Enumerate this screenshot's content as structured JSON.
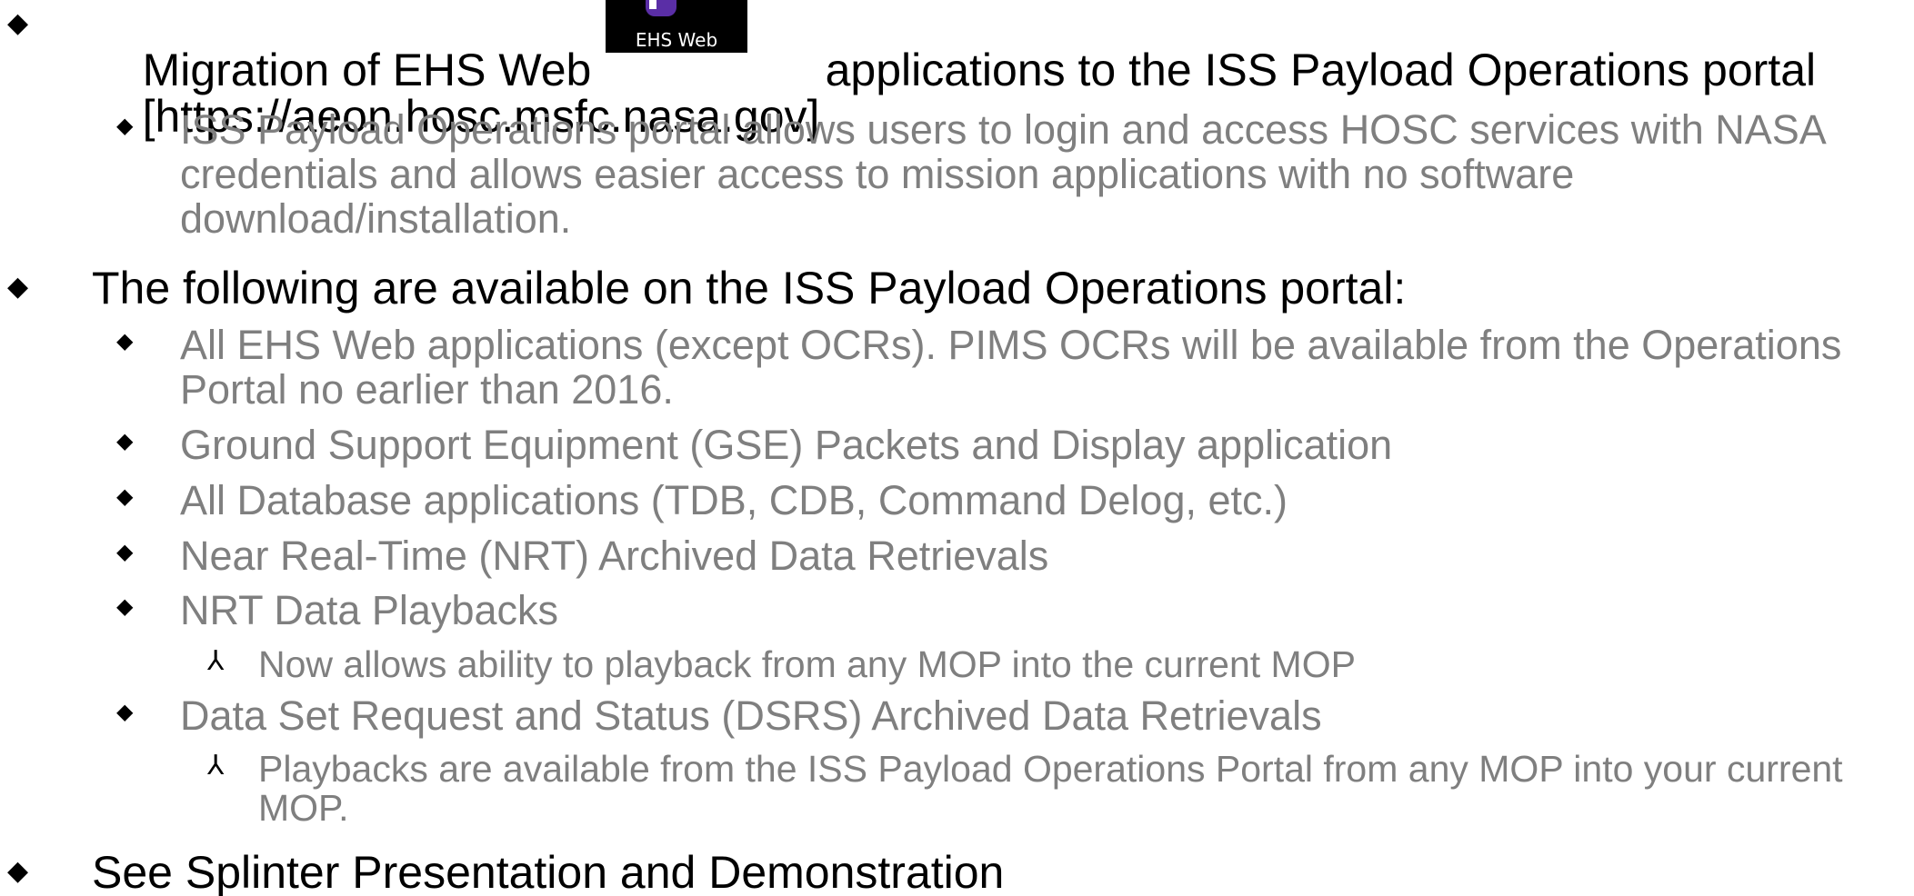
{
  "bullets": {
    "level1": "◆",
    "level2": "◆",
    "level3": "⅄"
  },
  "item1": {
    "text_before_icon": "Migration of EHS Web",
    "text_after_icon": "applications to the ISS Payload Operations portal",
    "text_line2": "[https://aeon.hosc.msfc.nasa.gov]",
    "icon_label": "EHS Web",
    "sub1": "ISS Payload Operations portal allows users to login and access HOSC services with NASA credentials and allows easier access to mission applications with no software download/installation."
  },
  "item2": {
    "text": "The following are available on the ISS Payload Operations portal:",
    "subs": [
      "All EHS Web applications (except OCRs). PIMS OCRs will be available from the Operations Portal no earlier than 2016.",
      "Ground Support Equipment (GSE) Packets and Display application",
      "All Database applications (TDB, CDB, Command Delog, etc.)",
      "Near Real-Time (NRT) Archived Data Retrievals",
      "NRT Data Playbacks",
      "Data Set Request and Status (DSRS) Archived Data Retrievals"
    ],
    "sub5_note": "Now allows ability to playback from any MOP into the current MOP",
    "sub6_note": "Playbacks are available from the ISS Payload Operations Portal from any MOP into your current MOP."
  },
  "item3": {
    "text": "See Splinter Presentation and Demonstration"
  }
}
